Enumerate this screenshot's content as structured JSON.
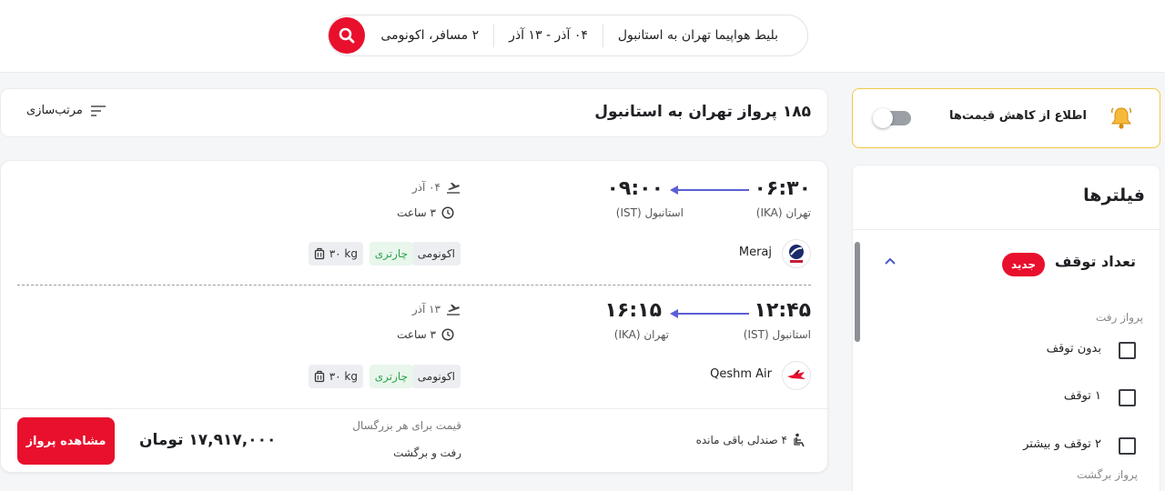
{
  "search": {
    "route": "بلیط هواپیما تهران به استانبول",
    "dates": "۰۴ آذر - ۱۳ آذر",
    "passengers": "۲ مسافر، اکونومی"
  },
  "results": {
    "title": "۱۸۵ پرواز تهران به استانبول",
    "sort_label": "مرتب‌سازی"
  },
  "flight": {
    "legs": [
      {
        "depart_time": "۰۶:۳۰",
        "arrive_time": "۰۹:۰۰",
        "from_airport": "تهران (IKA)",
        "to_airport": "استانبول (IST)",
        "date": "۰۴ آذر",
        "duration": "۳ ساعت",
        "airline": "Meraj",
        "cabin": "اکونومی",
        "type": "چارتری",
        "baggage": "۳۰ kg"
      },
      {
        "depart_time": "۱۲:۴۵",
        "arrive_time": "۱۶:۱۵",
        "from_airport": "استانبول (IST)",
        "to_airport": "تهران (IKA)",
        "date": "۱۳ آذر",
        "duration": "۳ ساعت",
        "airline": "Qeshm Air",
        "cabin": "اکونومی",
        "type": "چارتری",
        "baggage": "۳۰ kg"
      }
    ],
    "seats_left": "۴ صندلی باقی مانده",
    "price_note": "قیمت برای هر بزرگسال",
    "trip_type": "رفت و برگشت",
    "price": "۱۷,۹۱۷,۰۰۰ تومان",
    "view_button": "مشاهده پرواز"
  },
  "alert": {
    "label": "اطلاع از کاهش قیمت‌ها",
    "enabled": false
  },
  "filters": {
    "title": "فیلترها",
    "stops_section": "تعداد توقف",
    "new_badge": "جدید",
    "outbound_label": "پرواز رفت",
    "options": [
      "بدون توقف",
      "۱ توقف",
      "۲ توقف و بیشتر"
    ],
    "return_label": "پرواز برگشت"
  },
  "colors": {
    "brand_red": "#e8102d",
    "route_arrow": "#5b5fd6",
    "charter_green": "#2ea44f",
    "alert_border": "#f3c843"
  },
  "icons": [
    "search-icon",
    "sort-icon",
    "bell-icon",
    "takeoff-icon",
    "clock-icon",
    "luggage-icon",
    "seat-icon",
    "chevron-up-icon",
    "meraj-logo",
    "qeshm-air-logo"
  ]
}
